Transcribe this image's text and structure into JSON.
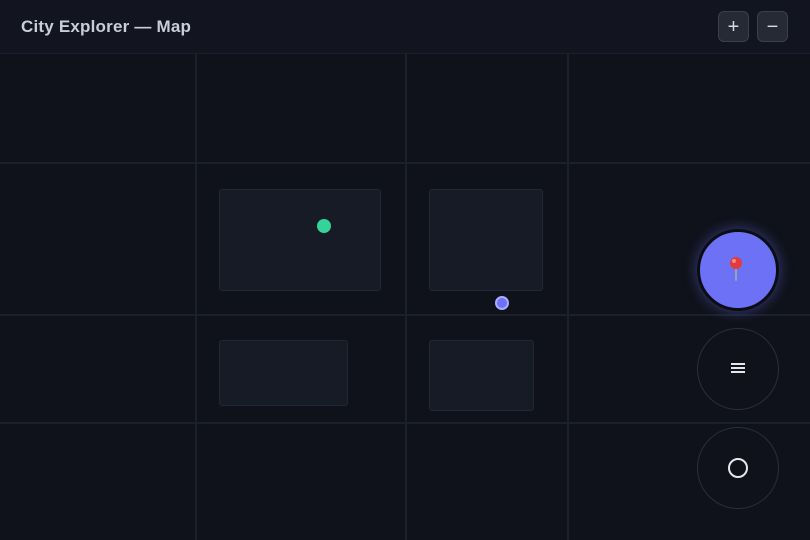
{
  "header": {
    "title": "City Explorer — Map",
    "zoom_in_label": "+",
    "zoom_out_label": "−"
  },
  "map": {
    "markers": [
      {
        "name": "green-marker",
        "color": "#34d399"
      },
      {
        "name": "current-location-marker",
        "color": "#6c71f6"
      }
    ]
  },
  "controls": {
    "buttons": [
      {
        "name": "pin-view-button",
        "icon": "pin-icon",
        "active": true
      },
      {
        "name": "list-view-button",
        "icon": "list-icon",
        "active": false
      },
      {
        "name": "locate-button",
        "icon": "target-icon",
        "active": false
      }
    ],
    "accent_color": "#6c71f6"
  }
}
